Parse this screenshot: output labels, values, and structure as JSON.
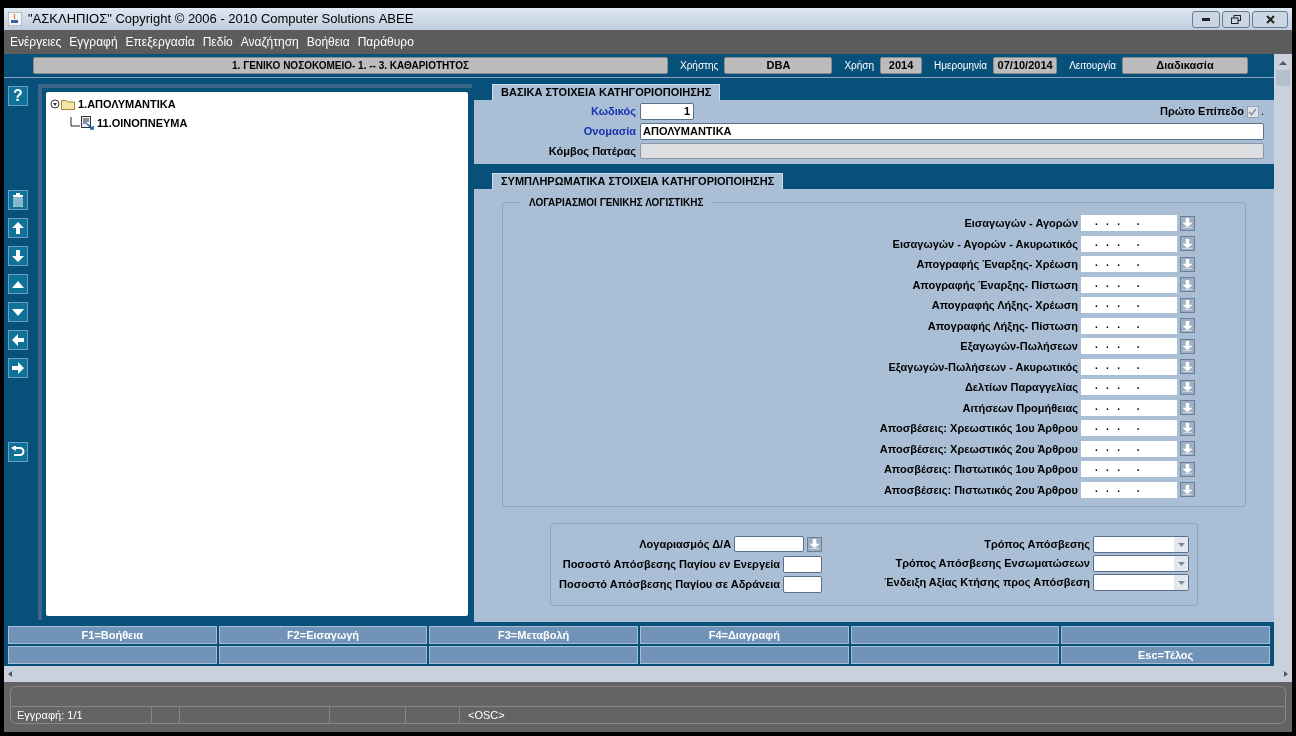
{
  "window": {
    "title": "\"ΑΣΚΛΗΠΙΟΣ\" Copyright © 2006 - 2010 Computer Solutions ΑΒΕΕ"
  },
  "menu": [
    "Ενέργειες",
    "Εγγραφή",
    "Επεξεργασία",
    "Πεδίο",
    "Αναζήτηση",
    "Βοήθεια",
    "Παράθυρο"
  ],
  "header": {
    "unit": "1. ΓΕΝΙΚΟ ΝΟΣΟΚΟΜΕΙΟ- 1. -- 3. ΚΑΘΑΡΙΟΤΗΤΟΣ",
    "fields": [
      {
        "label": "Χρήστης",
        "value": "DBA"
      },
      {
        "label": "Χρήση",
        "value": "2014"
      },
      {
        "label": "Ημερομηνία",
        "value": "07/10/2014"
      },
      {
        "label": "Λειτουργία",
        "value": "Διαδικασία"
      }
    ]
  },
  "toolbar": {
    "help": "?"
  },
  "tree": [
    {
      "label": "1.ΑΠΟΛΥΜΑΝΤΙΚΑ",
      "expanded": true,
      "children": [
        {
          "label": "11.ΟΙΝΟΠΝΕΥΜΑ"
        }
      ]
    }
  ],
  "basic": {
    "title": "ΒΑΣΙΚΑ ΣΤΟΙΧΕΙΑ ΚΑΤΗΓΟΡΙΟΠΟΙΗΣΗΣ",
    "code": {
      "label": "Κωδικός",
      "value": "1"
    },
    "name": {
      "label": "Ονομασία",
      "value": "ΑΠΟΛΥΜΑΝΤΙΚΑ"
    },
    "parent": {
      "label": "Κόμβος Πατέρας",
      "disabled": true
    },
    "first_level": {
      "label": "Πρώτο Επίπεδο",
      "checked": true,
      "disabled": true,
      "suffix": "."
    }
  },
  "extra": {
    "title": "ΣΥΜΠΛΗΡΩΜΑΤΙΚΑ ΣΤΟΙΧΕΙΑ ΚΑΤΗΓΟΡΙΟΠΟΙΗΣΗΣ",
    "accounts_title": "ΛΟΓΑΡΙΑΣΜΟΙ ΓΕΝΙΚΗΣ ΛΟΓΙΣΤΙΚΗΣ",
    "accounts": [
      {
        "label": "Εισαγωγών - Αγορών",
        "value": ".   .   .      ."
      },
      {
        "label": "Εισαγωγών - Αγορών  - Ακυρωτικός",
        "value": ".   .   .      ."
      },
      {
        "label": "Απογραφής Έναρξης- Χρέωση",
        "value": ".   .   .      ."
      },
      {
        "label": "Απογραφής Έναρξης- Πίστωση",
        "value": ".   .   .      ."
      },
      {
        "label": "Απογραφής Λήξης- Χρέωση",
        "value": ".   .   .      ."
      },
      {
        "label": "Απογραφής Λήξης- Πίστωση",
        "value": ".   .   .      ."
      },
      {
        "label": "Εξαγωγών-Πωλήσεων",
        "value": ".   .   .      ."
      },
      {
        "label": "Εξαγωγών-Πωλήσεων - Ακυρωτικός",
        "value": ".   .   .      ."
      },
      {
        "label": "Δελτίων Παραγγελίας",
        "value": ".   .   .      ."
      },
      {
        "label": "Αιτήσεων Προμήθειας",
        "value": ".   .   .      ."
      },
      {
        "label": "Αποσβέσεις: Χρεωστικός 1ου Άρθρου",
        "value": ".   .   .      ."
      },
      {
        "label": "Αποσβέσεις: Χρεωστικός 2ου Άρθρου",
        "value": ".   .   .      ."
      },
      {
        "label": "Αποσβέσεις: Πιστωτικός 1ου Άρθρου",
        "value": ".   .   .      ."
      },
      {
        "label": "Αποσβέσεις: Πιστωτικός 2ου Άρθρου",
        "value": ".   .   .      ."
      }
    ],
    "left_fields": [
      {
        "kind": "lookup",
        "label": "Λογαριασμός Δ/Α"
      },
      {
        "kind": "short",
        "label": "Ποσοστό Απόσβεσης Παγίου εν Ενεργεία"
      },
      {
        "kind": "short",
        "label": "Ποσοστό Απόσβεσης Παγίου σε Αδράνεια"
      }
    ],
    "right_fields": [
      {
        "label": "Τρόπος Απόσβεσης"
      },
      {
        "label": "Τρόπος Απόσβεσης Ενσωματώσεων"
      },
      {
        "label": "Ένδειξη Αξίας Κτήσης προς Απόσβεση"
      }
    ]
  },
  "function_keys": [
    {
      "kind": "key",
      "label": "F1=Βοήθεια"
    },
    {
      "kind": "key",
      "label": "F2=Εισαγωγή"
    },
    {
      "kind": "key",
      "label": "F3=Μεταβολή"
    },
    {
      "kind": "key",
      "label": "F4=Διαγραφή"
    },
    {
      "kind": "blank"
    },
    {
      "kind": "blank"
    },
    {
      "kind": "blank"
    },
    {
      "kind": "blank"
    },
    {
      "kind": "blank"
    },
    {
      "kind": "blank"
    },
    {
      "kind": "blank"
    },
    {
      "kind": "key",
      "label": "Esc=Τέλος"
    }
  ],
  "status_bar": {
    "record": "Εγγραφή: 1/1",
    "mode": "<OSC>"
  }
}
